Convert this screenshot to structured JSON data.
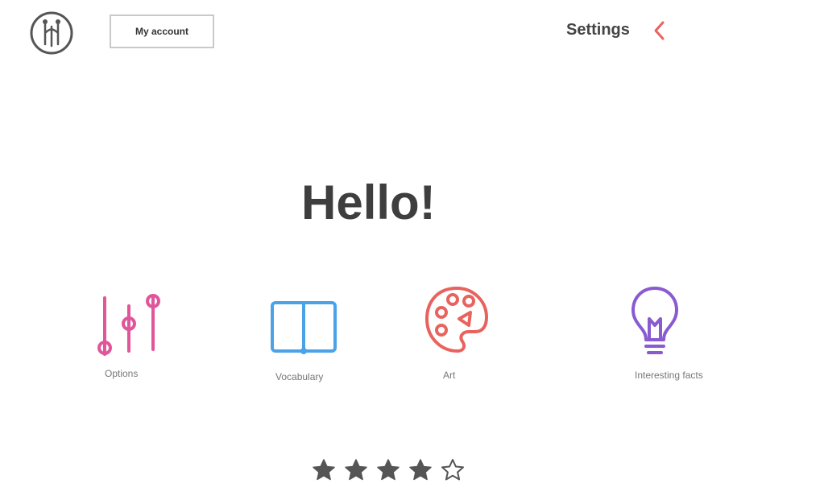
{
  "header": {
    "button_label": "My account",
    "settings_label": "Settings"
  },
  "main": {
    "greeting": "Hello!"
  },
  "tiles": [
    {
      "label": "Options",
      "icon": "sliders-icon",
      "color": "#e0569a"
    },
    {
      "label": "Vocabulary",
      "icon": "book-icon",
      "color": "#4aa3e8"
    },
    {
      "label": "Art",
      "icon": "palette-icon",
      "color": "#e8635e"
    },
    {
      "label": "Interesting facts",
      "icon": "lightbulb-icon",
      "color": "#8a5ad1"
    }
  ],
  "rating": {
    "value": 4,
    "max": 5
  },
  "colors": {
    "accent": "#e8635e",
    "text": "#3e3e3e"
  }
}
